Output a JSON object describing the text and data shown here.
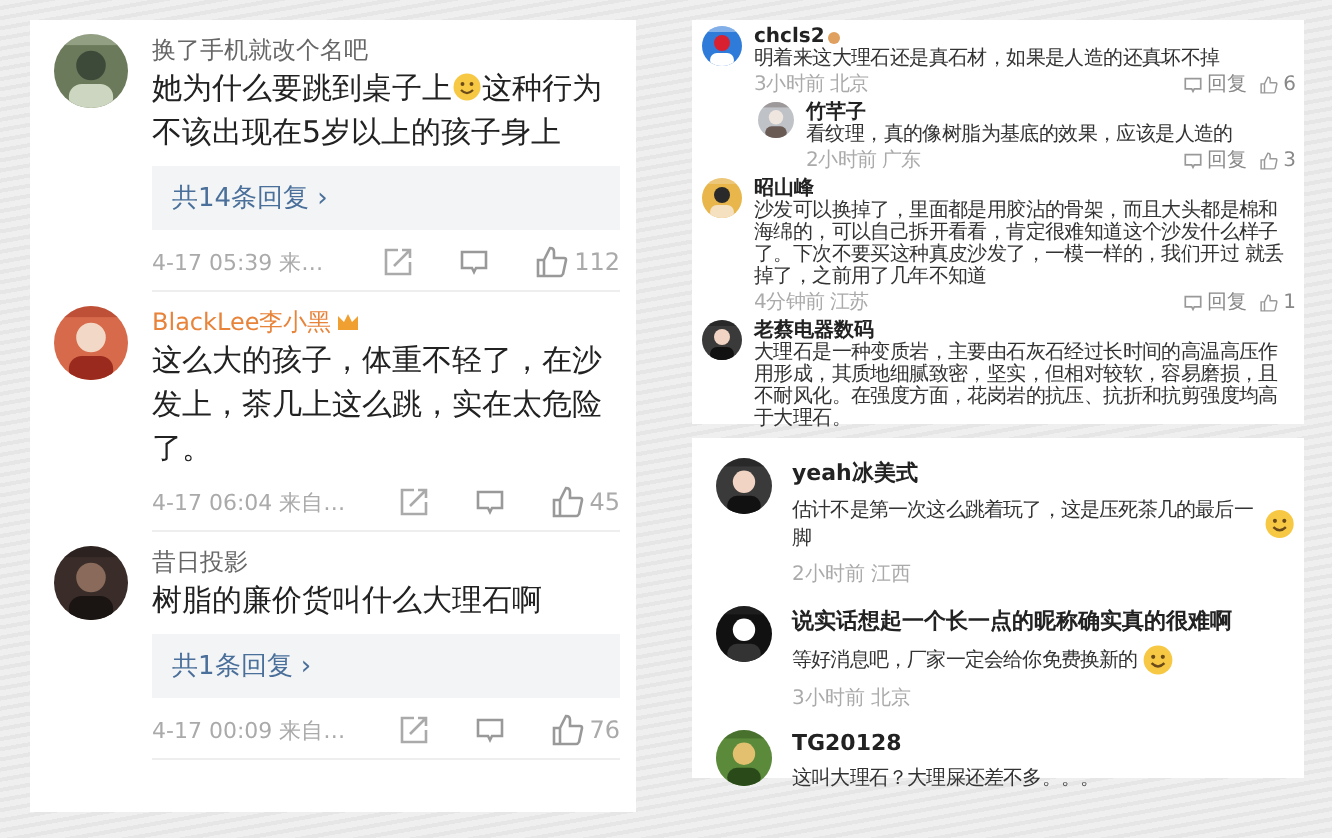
{
  "weibo_panel": {
    "comments": [
      {
        "name": "换了手机就改个名吧",
        "vip": false,
        "body": [
          {
            "kind": "text",
            "text": "她为什么要跳到桌子上"
          },
          {
            "kind": "emoji"
          },
          {
            "kind": "text",
            "text": "这种行为"
          },
          {
            "kind": "text",
            "text": "不该出现在5岁以上的孩子身上"
          }
        ],
        "replies": "共14条回复 ›",
        "time": "4-17 05:39 来…",
        "likes": "112"
      },
      {
        "name": "BlackLee李小黑",
        "vip": true,
        "body": [
          {
            "kind": "text",
            "text": "这么大的孩子，体重不轻了，在沙发上，茶几上这么跳，实在太危险了。"
          }
        ],
        "time": "4-17 06:04 来自…",
        "likes": "45"
      },
      {
        "name": "昔日投影",
        "vip": false,
        "body": [
          {
            "kind": "text",
            "text": "树脂的廉价货叫什么大理石啊"
          }
        ],
        "replies": "共1条回复 ›",
        "time": "4-17 00:09 来自…",
        "likes": "76"
      }
    ]
  },
  "web_panel": {
    "comments": [
      {
        "name": "chcls2",
        "badge": true,
        "text": "明着来这大理石还是真石材，如果是人造的还真坏不掉",
        "meta": "3小时前 北京",
        "reply": "回复",
        "likes": "6",
        "children": [
          {
            "name": "竹芊子",
            "badge": false,
            "text": "看纹理，真的像树脂为基底的效果，应该是人造的",
            "meta": "2小时前 广东",
            "reply": "回复",
            "likes": "3"
          }
        ]
      },
      {
        "name": "昭山峰",
        "badge": false,
        "text": "沙发可以换掉了，里面都是用胶沾的骨架，而且大头都是棉和海绵的，可以自己拆开看看，肯定很难知道这个沙发什么样子了。下次不要买这种真皮沙发了，一模一样的，我们开过 就丢掉了，之前用了几年不知道",
        "meta": "4分钟前 江苏",
        "reply": "回复",
        "likes": "1"
      },
      {
        "name": "老蔡电器数码",
        "badge": false,
        "text": "大理石是一种变质岩，主要由石灰石经过长时间的高温高压作用形成，其质地细腻致密，坚实，但相对较软，容易磨损，且不耐风化。在强度方面，花岗岩的抗压、抗折和抗剪强度均高于大理石。"
      }
    ]
  },
  "app_panel": {
    "comments": [
      {
        "name": "yeah冰美式",
        "text": "估计不是第一次这么跳着玩了，这是压死茶几的最后一脚",
        "emoji": true,
        "meta": "2小时前  江西"
      },
      {
        "name": "说实话想起一个长一点的昵称确实真的很难啊",
        "text": "等好消息吧，厂家一定会给你免费换新的",
        "emoji": true,
        "meta": "3小时前  北京"
      },
      {
        "name": "TG20128",
        "text": "这叫大理石？大理屎还差不多。。。",
        "emoji": false
      }
    ]
  }
}
